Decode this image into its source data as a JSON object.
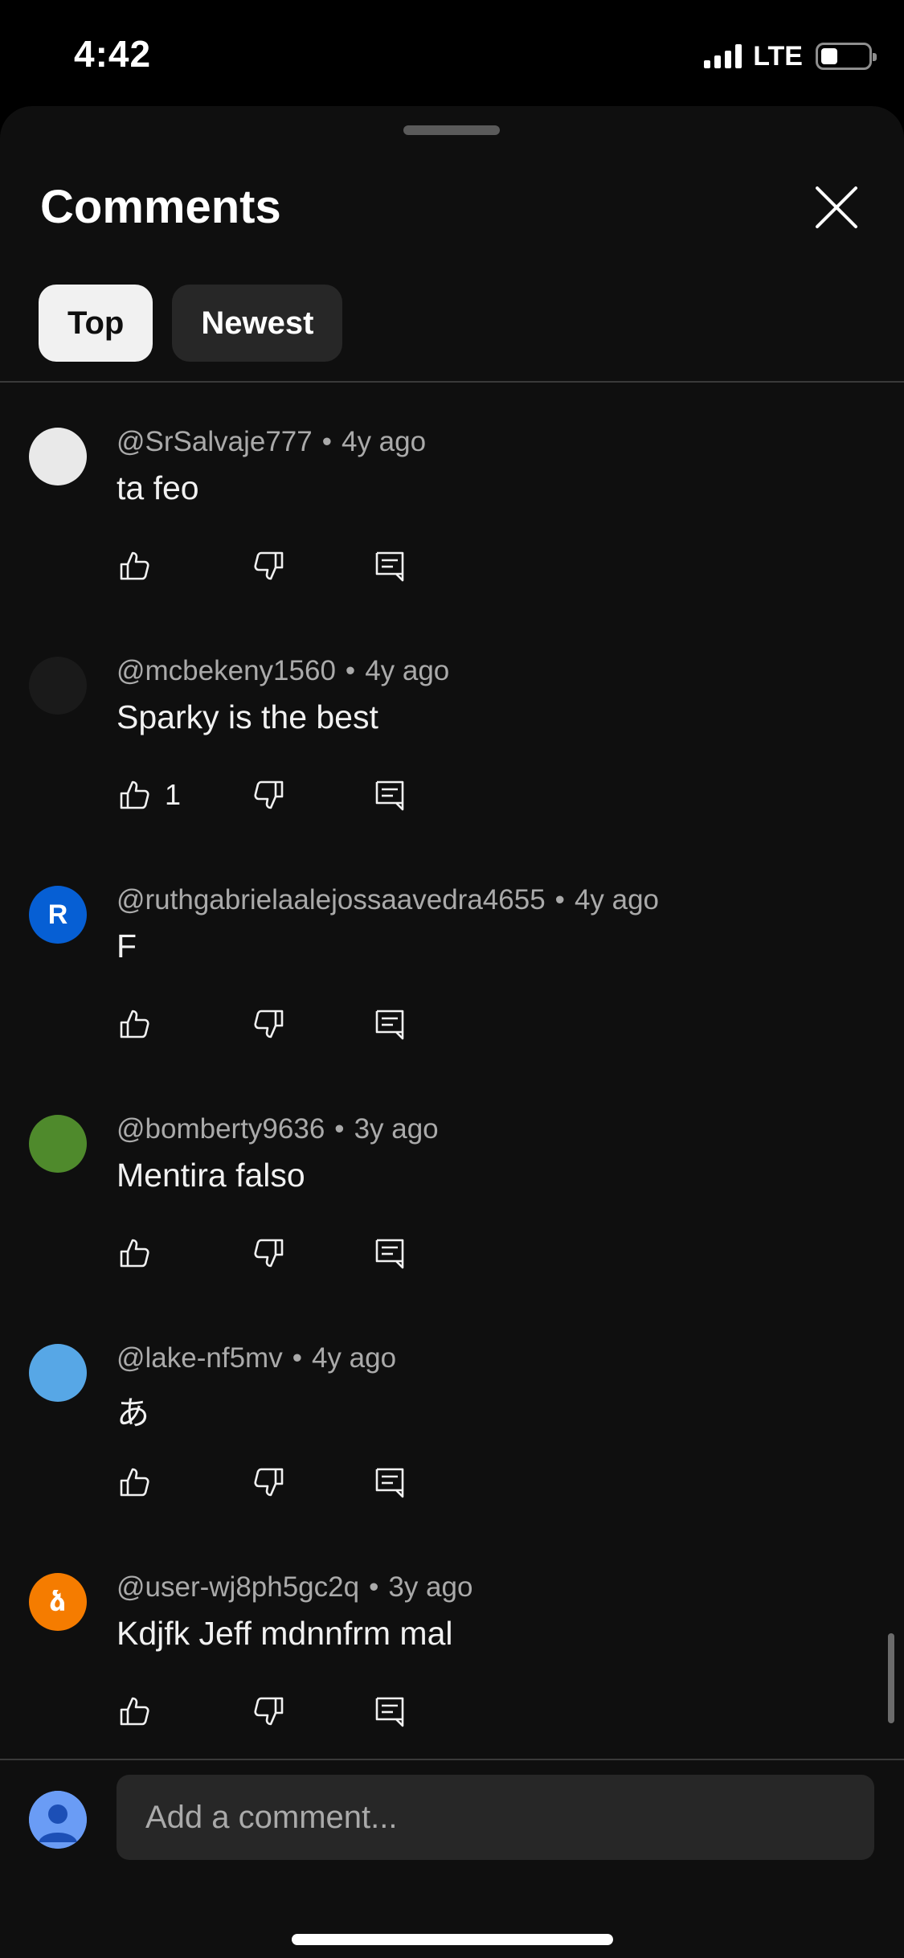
{
  "status_bar": {
    "time": "4:42",
    "network": "LTE",
    "battery_level": 0.35
  },
  "sheet": {
    "title": "Comments",
    "close_icon": "close-icon",
    "sort_chips": [
      {
        "label": "Top",
        "active": true
      },
      {
        "label": "Newest",
        "active": false
      }
    ]
  },
  "comments": [
    {
      "author": "@SrSalvaje777",
      "age": "4y ago",
      "text": "ta feo",
      "likes": "",
      "avatar_color": "#e9e9e9",
      "avatar_letter": "",
      "avatar_icon": "profile-photo"
    },
    {
      "author": "@mcbekeny1560",
      "age": "4y ago",
      "text": "Sparky is the best",
      "likes": "1",
      "avatar_color": "#1a1a1a",
      "avatar_letter": "",
      "avatar_icon": "profile-photo"
    },
    {
      "author": "@ruthgabrielaalejossaavedra4655",
      "age": "4y ago",
      "text": "F",
      "likes": "",
      "avatar_color": "#065fd4",
      "avatar_letter": "R",
      "avatar_icon": "letter-avatar"
    },
    {
      "author": "@bomberty9636",
      "age": "3y ago",
      "text": "Mentira falso",
      "likes": "",
      "avatar_color": "#4f8a2c",
      "avatar_letter": "",
      "avatar_icon": "profile-photo"
    },
    {
      "author": "@lake-nf5mv",
      "age": "4y ago",
      "text": "あ",
      "likes": "",
      "avatar_color": "#57a7e6",
      "avatar_letter": "",
      "avatar_icon": "profile-photo"
    },
    {
      "author": "@user-wj8ph5gc2q",
      "age": "3y ago",
      "text": "Kdjfk Jeff mdnnfrm mal",
      "likes": "",
      "avatar_color": "#f57c00",
      "avatar_letter": "ձ",
      "avatar_icon": "letter-avatar"
    }
  ],
  "composer": {
    "placeholder": "Add a comment...",
    "avatar_icon": "default-user-avatar"
  },
  "icons": {
    "like": "thumbs-up-icon",
    "dislike": "thumbs-down-icon",
    "reply": "reply-icon"
  }
}
